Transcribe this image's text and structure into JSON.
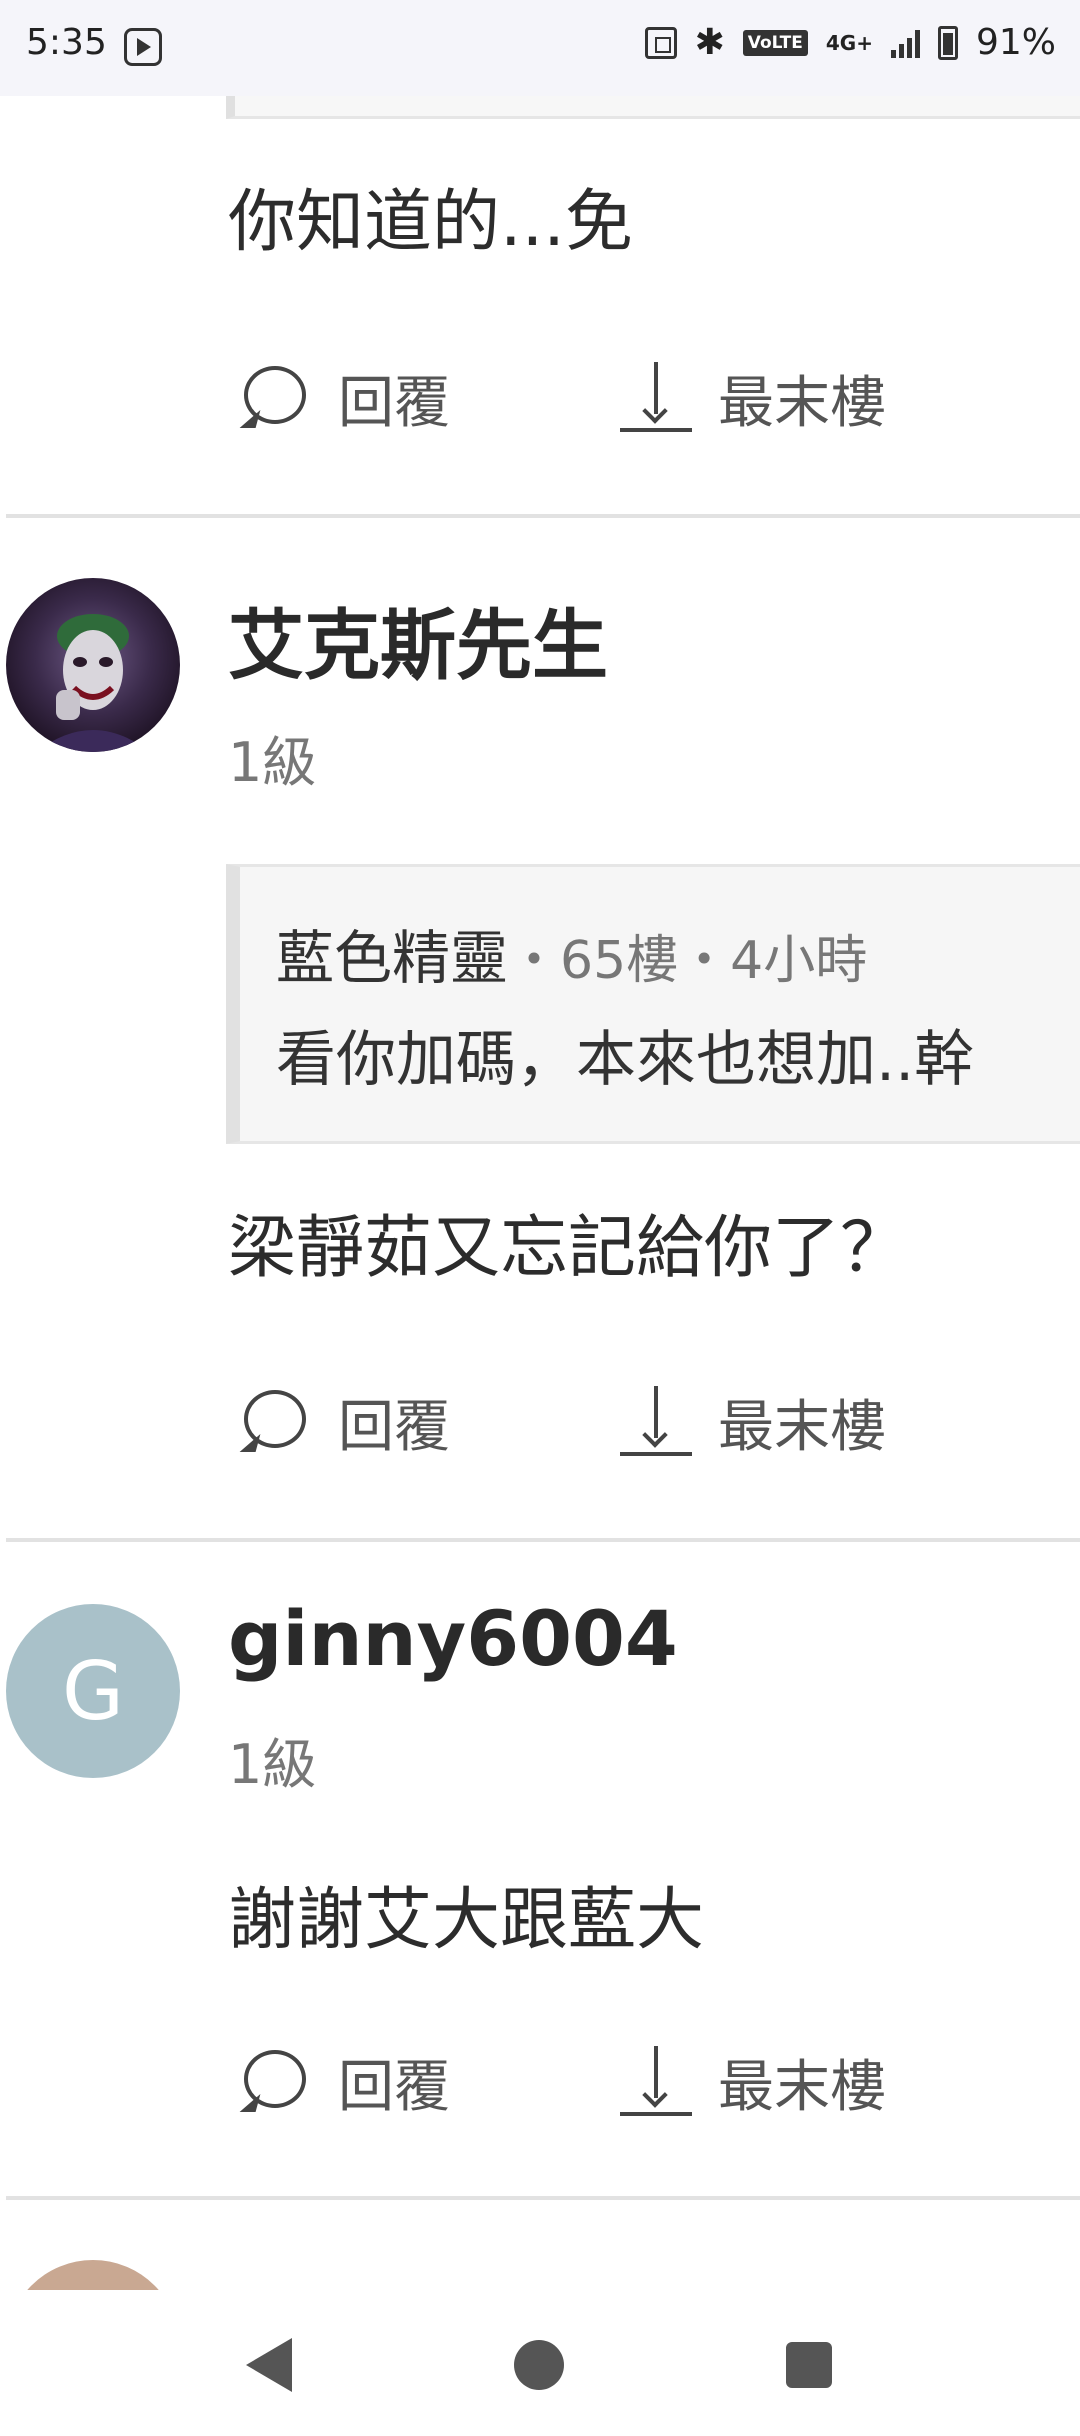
{
  "status_bar": {
    "time": "5:35",
    "network": "4G+",
    "volte": "VoLTE",
    "battery": "91%"
  },
  "comments": [
    {
      "body": "你知道的...免",
      "reply_label": "回覆",
      "last_floor_label": "最末樓"
    },
    {
      "author": "艾克斯先生",
      "level": "1級",
      "quote": {
        "author": "藍色精靈",
        "floor": "・65樓・4小時",
        "text": "看你加碼，本來也想加..幹"
      },
      "body": "梁靜茹又忘記給你了？",
      "reply_label": "回覆",
      "last_floor_label": "最末樓"
    },
    {
      "author": "ginny6004",
      "avatar_letter": "G",
      "level": "1級",
      "body": "謝謝艾大跟藍大",
      "reply_label": "回覆",
      "last_floor_label": "最末樓"
    }
  ],
  "colors": {
    "avatar_g_bg": "#a9c1c9",
    "separator": "#e2e2e2"
  }
}
